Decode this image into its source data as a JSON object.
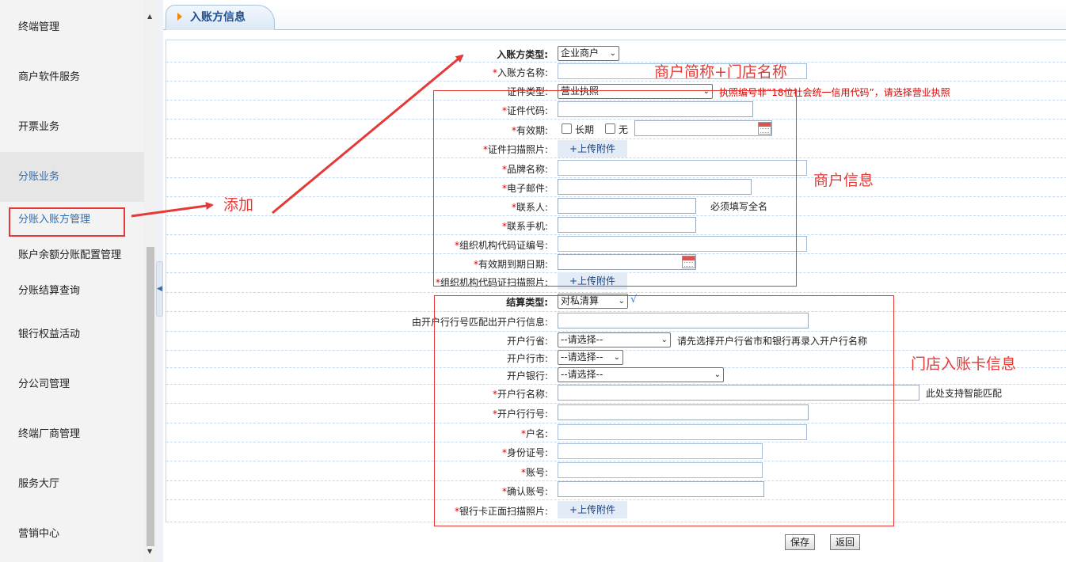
{
  "sidebar": {
    "items": [
      "终端管理",
      "商户软件服务",
      "开票业务",
      "分账业务",
      "银行权益活动",
      "分公司管理",
      "终端厂商管理",
      "服务大厅",
      "营销中心"
    ],
    "sub_items": [
      "分账入账方管理",
      "账户余额分账配置管理",
      "分账结算查询"
    ]
  },
  "tab": {
    "title": "入账方信息"
  },
  "form": {
    "payee_type_label": "入账方类型:",
    "payee_type_value": "企业商户",
    "payee_name_label": "入账方名称:",
    "cert_type_label": "证件类型:",
    "cert_type_value": "营业执照",
    "cert_type_hint": "执照编号非“18位社会统一信用代码”，请选择营业执照",
    "cert_code_label": "证件代码:",
    "validity_label": "有效期:",
    "validity_long": "长期",
    "validity_none": "无",
    "cert_scan_label": "证件扫描照片:",
    "upload_label": "+上传附件",
    "brand_label": "品牌名称:",
    "email_label": "电子邮件:",
    "contact_label": "联系人:",
    "contact_hint": "必须填写全名",
    "mobile_label": "联系手机:",
    "org_code_label": "组织机构代码证编号:",
    "expiry_label": "有效期到期日期:",
    "org_scan_label": "组织机构代码证扫描照片:",
    "settle_type_label": "结算类型:",
    "settle_type_value": "对私清算",
    "match_bank_label": "由开户行行号匹配出开户行信息:",
    "province_label": "开户行省:",
    "select_placeholder": "--请选择--",
    "province_hint": "请先选择开户行省市和银行再录入开户行名称",
    "city_label": "开户行市:",
    "bank_label": "开户银行:",
    "branch_name_label": "开户行名称:",
    "branch_name_hint": "此处支持智能匹配",
    "branch_no_label": "开户行行号:",
    "account_name_label": "户名:",
    "id_no_label": "身份证号:",
    "account_no_label": "账号:",
    "confirm_account_label": "确认账号:",
    "card_scan_label": "银行卡正面扫描照片:",
    "required_mark": "*"
  },
  "buttons": {
    "save": "保存",
    "back": "返回"
  },
  "annotations": {
    "add": "添加",
    "name_note": "商户简称+门店名称",
    "merchant_info": "商户信息",
    "card_info": "门店入账卡信息",
    "color": "#e53935"
  }
}
